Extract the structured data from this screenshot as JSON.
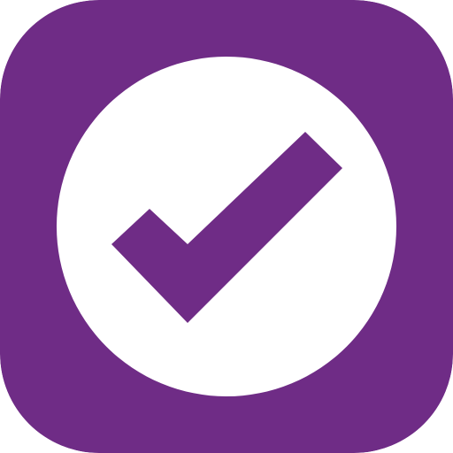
{
  "app_icon": {
    "icon": "checkmark-in-circle-icon",
    "colors": {
      "tile_background": "#6f2c86",
      "circle_fill": "#ffffff",
      "checkmark": "#6f2c86"
    }
  }
}
